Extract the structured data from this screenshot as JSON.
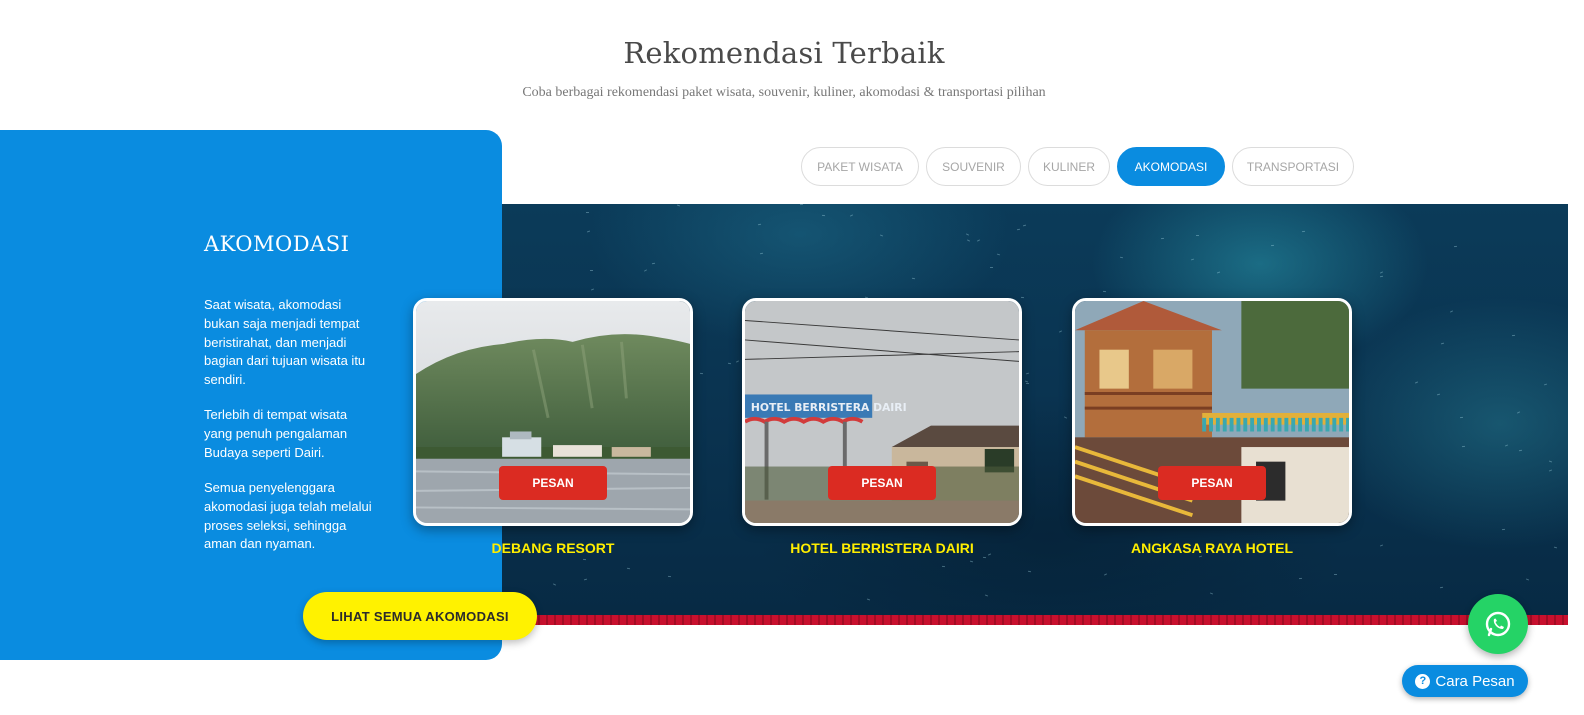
{
  "section": {
    "title": "Rekomendasi Terbaik",
    "subtitle": "Coba berbagai rekomendasi paket wisata, souvenir, kuliner, akomodasi & transportasi pilihan"
  },
  "tabs": [
    {
      "label": "PAKET WISATA",
      "active": false
    },
    {
      "label": "SOUVENIR",
      "active": false
    },
    {
      "label": "KULINER",
      "active": false
    },
    {
      "label": "AKOMODASI",
      "active": true
    },
    {
      "label": "TRANSPORTASI",
      "active": false
    }
  ],
  "panel": {
    "heading": "AKOMODASI",
    "paragraphs": [
      "Saat wisata, akomodasi bukan saja menjadi tempat beristirahat, dan menjadi bagian dari tujuan wisata itu sendiri.",
      "Terlebih di tempat wisata yang penuh pengalaman Budaya seperti Dairi.",
      "Semua penyelenggara akomodasi juga telah melalui proses seleksi, sehingga aman dan nyaman."
    ],
    "cta_label": "LIHAT SEMUA AKOMODASI"
  },
  "cards": [
    {
      "title": "DEBANG RESORT",
      "button_label": "PESAN"
    },
    {
      "title": "HOTEL BERRISTERA DAIRI",
      "button_label": "PESAN",
      "sign_text": "HOTEL BERRISTERA DAIRI"
    },
    {
      "title": "ANGKASA RAYA HOTEL",
      "button_label": "PESAN"
    }
  ],
  "floating": {
    "whatsapp_icon": "whatsapp-icon",
    "cara_pesan_label": "Cara Pesan",
    "cara_pesan_icon": "question-circle-icon"
  },
  "colors": {
    "primary_blue": "#0a8ce0",
    "accent_yellow": "#fff200",
    "title_yellow": "#ffee00",
    "button_red": "#db2b22",
    "whatsapp_green": "#25d366"
  }
}
